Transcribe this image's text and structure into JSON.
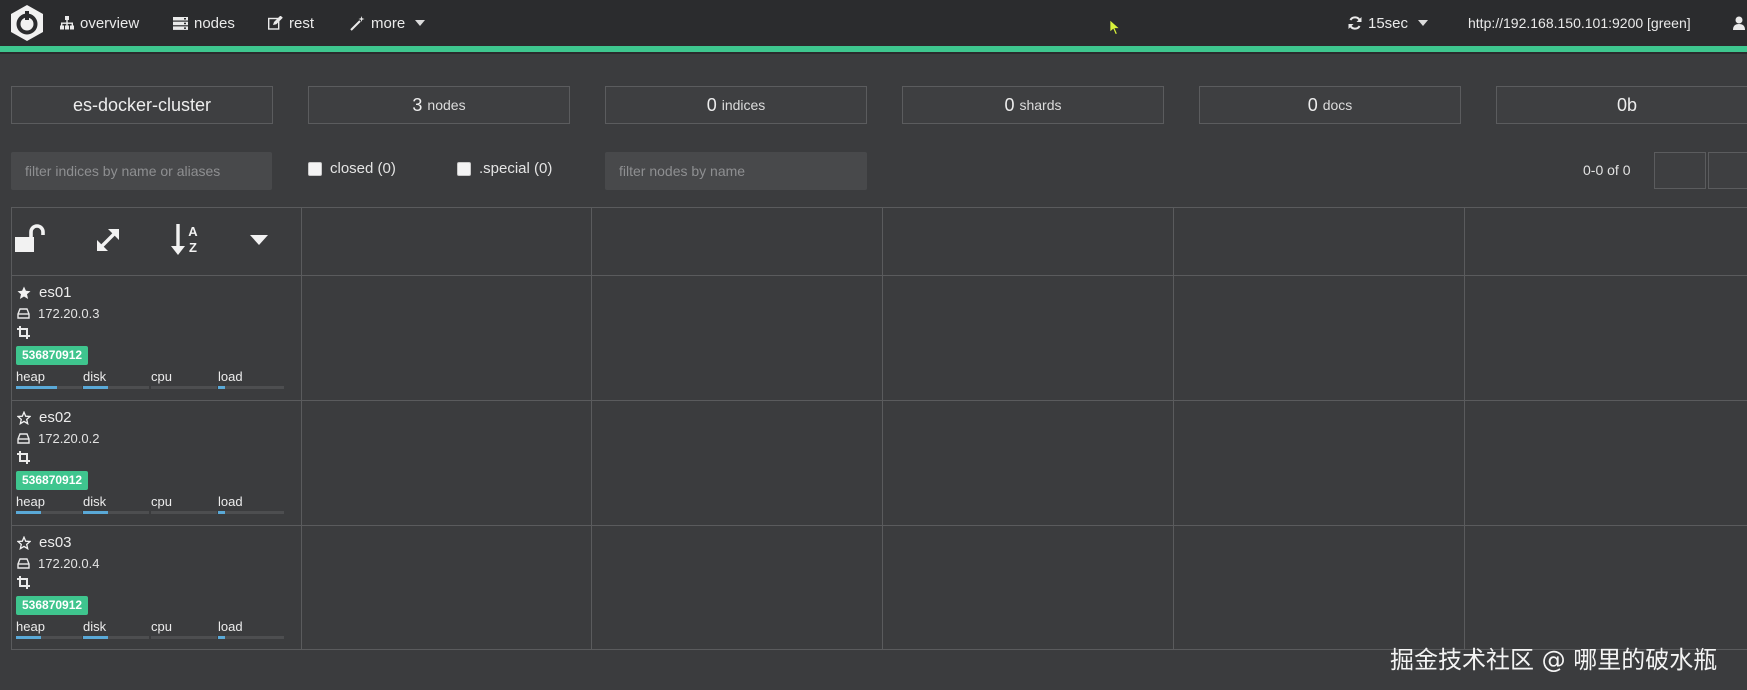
{
  "navbar": {
    "items": [
      {
        "label": "overview",
        "icon": "sitemap-icon"
      },
      {
        "label": "nodes",
        "icon": "server-icon"
      },
      {
        "label": "rest",
        "icon": "edit-icon"
      },
      {
        "label": "more",
        "icon": "wand-icon"
      }
    ],
    "refresh": {
      "label": "15sec",
      "icon": "refresh-icon"
    },
    "cluster_url": "http://192.168.150.101:9200 [green]",
    "accent_color": "#3ec78f"
  },
  "stats": {
    "cluster_name": "es-docker-cluster",
    "nodes": {
      "value": "3",
      "label": "nodes"
    },
    "indices": {
      "value": "0",
      "label": "indices"
    },
    "shards": {
      "value": "0",
      "label": "shards"
    },
    "docs": {
      "value": "0",
      "label": "docs"
    },
    "size": {
      "value": "0b"
    }
  },
  "filters": {
    "indices_placeholder": "filter indices by name or aliases",
    "closed_label": "closed (0)",
    "special_label": ".special (0)",
    "nodes_placeholder": "filter nodes by name",
    "pagination": "0-0 of 0"
  },
  "nodes": [
    {
      "name": "es01",
      "master": true,
      "ip": "172.20.0.3",
      "badge": "536870912",
      "metrics": [
        {
          "label": "heap",
          "level": 0.62
        },
        {
          "label": "disk",
          "level": 0.38
        },
        {
          "label": "cpu",
          "level": 0.0
        },
        {
          "label": "load",
          "level": 0.1
        }
      ]
    },
    {
      "name": "es02",
      "master": false,
      "ip": "172.20.0.2",
      "badge": "536870912",
      "metrics": [
        {
          "label": "heap",
          "level": 0.38
        },
        {
          "label": "disk",
          "level": 0.38
        },
        {
          "label": "cpu",
          "level": 0.0
        },
        {
          "label": "load",
          "level": 0.1
        }
      ]
    },
    {
      "name": "es03",
      "master": false,
      "ip": "172.20.0.4",
      "badge": "536870912",
      "metrics": [
        {
          "label": "heap",
          "level": 0.38
        },
        {
          "label": "disk",
          "level": 0.38
        },
        {
          "label": "cpu",
          "level": 0.0
        },
        {
          "label": "load",
          "level": 0.1
        }
      ]
    }
  ],
  "watermark": "掘金技术社区 @ 哪里的破水瓶"
}
